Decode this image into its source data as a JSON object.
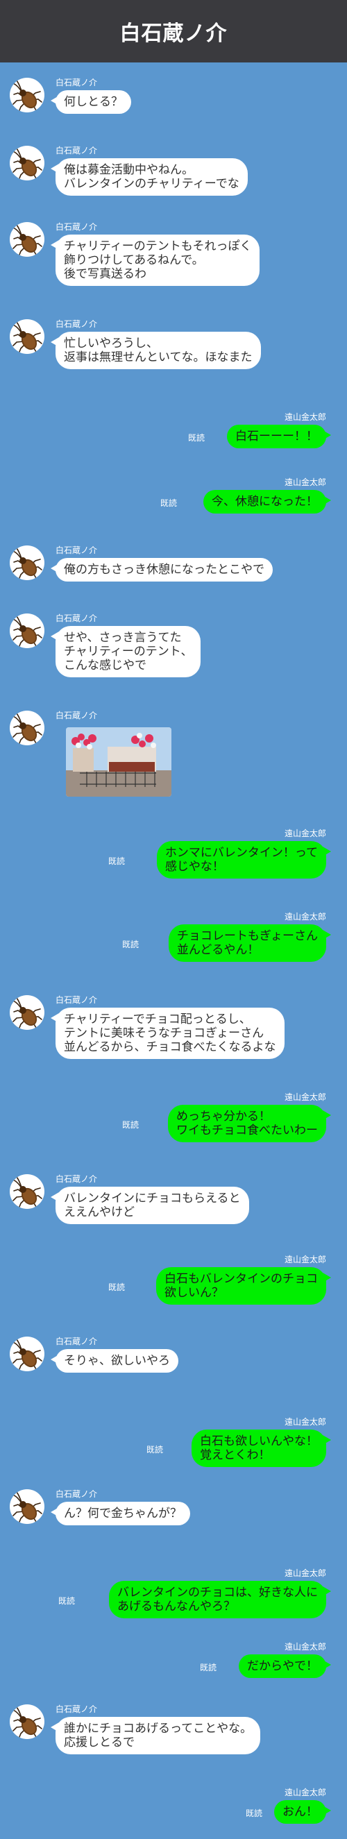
{
  "header": {
    "title": "白石蔵ノ介"
  },
  "characters": {
    "left": "白石蔵ノ介",
    "right": "遠山金太郎"
  },
  "read_label": "既読",
  "messages": [
    {
      "side": "left",
      "lines": [
        "何しとる？"
      ]
    },
    {
      "side": "left",
      "lines": [
        "俺は募金活動中やねん。",
        "バレンタインのチャリティーでな"
      ]
    },
    {
      "side": "left",
      "lines": [
        "チャリティーのテントもそれっぽく",
        "飾りつけしてあるねんで。",
        "後で写真送るわ"
      ]
    },
    {
      "side": "left",
      "lines": [
        "忙しいやろうし、",
        "返事は無理せんといてな。ほなまた"
      ]
    },
    {
      "side": "right",
      "lines": [
        "白石ーーー！！"
      ]
    },
    {
      "side": "right",
      "lines": [
        "今、休憩になった！"
      ]
    },
    {
      "side": "left",
      "lines": [
        "俺の方もさっき休憩になったとこやで"
      ]
    },
    {
      "side": "left",
      "lines": [
        "せや、さっき言うてた",
        "チャリティーのテント、",
        "こんな感じやで"
      ]
    },
    {
      "side": "left",
      "lines": [],
      "photo": "tent-photo"
    },
    {
      "side": "right",
      "lines": [
        "ホンマにバレンタイン！って",
        "感じやな！"
      ]
    },
    {
      "side": "right",
      "lines": [
        "チョコレートもぎょーさん",
        "並んどるやん！"
      ]
    },
    {
      "side": "left",
      "lines": [
        "チャリティーでチョコ配っとるし、",
        "テントに美味そうなチョコぎょーさん",
        "並んどるから、チョコ食べたくなるよな"
      ]
    },
    {
      "side": "right",
      "lines": [
        "めっちゃ分かる！",
        "ワイもチョコ食べたいわー"
      ]
    },
    {
      "side": "left",
      "lines": [
        "バレンタインにチョコもらえると",
        "ええんやけど"
      ]
    },
    {
      "side": "right",
      "lines": [
        "白石もバレンタインのチョコ",
        "欲しいん？"
      ]
    },
    {
      "side": "left",
      "lines": [
        "そりゃ、欲しいやろ"
      ]
    },
    {
      "side": "right",
      "lines": [
        "白石も欲しいんやな！",
        "覚えとくわ！"
      ]
    },
    {
      "side": "left",
      "lines": [
        "ん？何で金ちゃんが？"
      ]
    },
    {
      "side": "right",
      "lines": [
        "バレンタインのチョコは、好きな人に",
        "あげるもんなんやろ？"
      ]
    },
    {
      "side": "right",
      "lines": [
        "だからやで！"
      ]
    },
    {
      "side": "left",
      "lines": [
        "誰かにチョコあげるってことやな。",
        "応援しとるで"
      ]
    },
    {
      "side": "right",
      "lines": [
        "おん！"
      ]
    }
  ],
  "colors": {
    "background": "#5b97cf",
    "header": "#3a3a3e",
    "left_bubble": "#ffffff",
    "right_bubble": "#00ee00"
  },
  "icons": {
    "avatar": "beetle-icon"
  }
}
